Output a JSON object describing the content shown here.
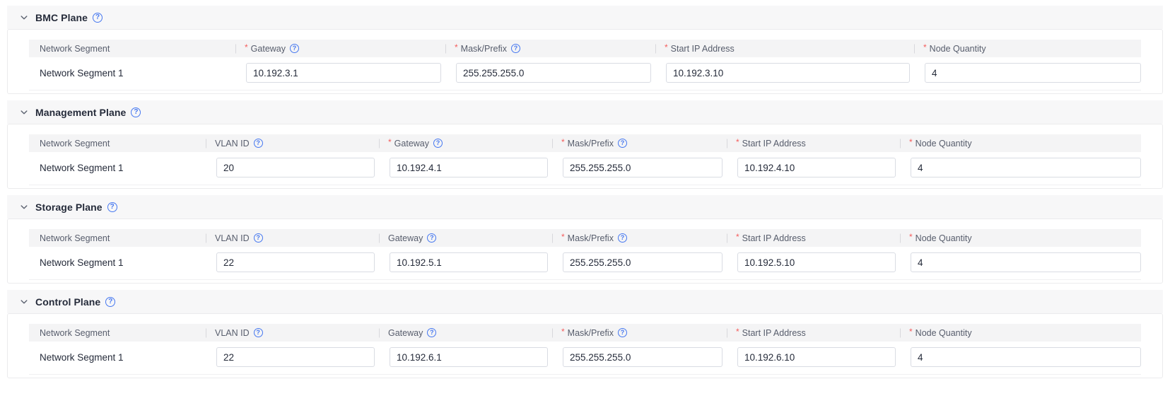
{
  "ui": {
    "required_marker": "*",
    "help_glyph": "?"
  },
  "colors": {
    "help_icon_blue": "#4678f0",
    "required_red": "#f45c5c",
    "section_header_bg": "#f7f7f8",
    "table_header_bg": "#f4f4f5"
  },
  "sections": [
    {
      "id": "bmc-plane",
      "title": "BMC Plane",
      "title_help": true,
      "columns": [
        {
          "label": "Network Segment",
          "required": false,
          "help": false
        },
        {
          "label": "Gateway",
          "required": true,
          "help": true
        },
        {
          "label": "Mask/Prefix",
          "required": true,
          "help": true
        },
        {
          "label": "Start IP Address",
          "required": true,
          "help": false
        },
        {
          "label": "Node Quantity",
          "required": true,
          "help": false
        }
      ],
      "rows": [
        {
          "segment": "Network Segment 1",
          "inputs": [
            "10.192.3.1",
            "255.255.255.0",
            "10.192.3.10",
            "4"
          ]
        }
      ]
    },
    {
      "id": "management-plane",
      "title": "Management Plane",
      "title_help": true,
      "columns": [
        {
          "label": "Network Segment",
          "required": false,
          "help": false
        },
        {
          "label": "VLAN ID",
          "required": false,
          "help": true
        },
        {
          "label": "Gateway",
          "required": true,
          "help": true
        },
        {
          "label": "Mask/Prefix",
          "required": true,
          "help": true
        },
        {
          "label": "Start IP Address",
          "required": true,
          "help": false
        },
        {
          "label": "Node Quantity",
          "required": true,
          "help": false
        }
      ],
      "rows": [
        {
          "segment": "Network Segment 1",
          "inputs": [
            "20",
            "10.192.4.1",
            "255.255.255.0",
            "10.192.4.10",
            "4"
          ]
        }
      ]
    },
    {
      "id": "storage-plane",
      "title": "Storage Plane",
      "title_help": true,
      "columns": [
        {
          "label": "Network Segment",
          "required": false,
          "help": false
        },
        {
          "label": "VLAN ID",
          "required": false,
          "help": true
        },
        {
          "label": "Gateway",
          "required": false,
          "help": true
        },
        {
          "label": "Mask/Prefix",
          "required": true,
          "help": true
        },
        {
          "label": "Start IP Address",
          "required": true,
          "help": false
        },
        {
          "label": "Node Quantity",
          "required": true,
          "help": false
        }
      ],
      "rows": [
        {
          "segment": "Network Segment 1",
          "inputs": [
            "22",
            "10.192.5.1",
            "255.255.255.0",
            "10.192.5.10",
            "4"
          ]
        }
      ]
    },
    {
      "id": "control-plane",
      "title": "Control Plane",
      "title_help": true,
      "columns": [
        {
          "label": "Network Segment",
          "required": false,
          "help": false
        },
        {
          "label": "VLAN ID",
          "required": false,
          "help": true
        },
        {
          "label": "Gateway",
          "required": false,
          "help": true
        },
        {
          "label": "Mask/Prefix",
          "required": true,
          "help": true
        },
        {
          "label": "Start IP Address",
          "required": true,
          "help": false
        },
        {
          "label": "Node Quantity",
          "required": true,
          "help": false
        }
      ],
      "rows": [
        {
          "segment": "Network Segment 1",
          "inputs": [
            "22",
            "10.192.6.1",
            "255.255.255.0",
            "10.192.6.10",
            "4"
          ]
        }
      ]
    }
  ]
}
